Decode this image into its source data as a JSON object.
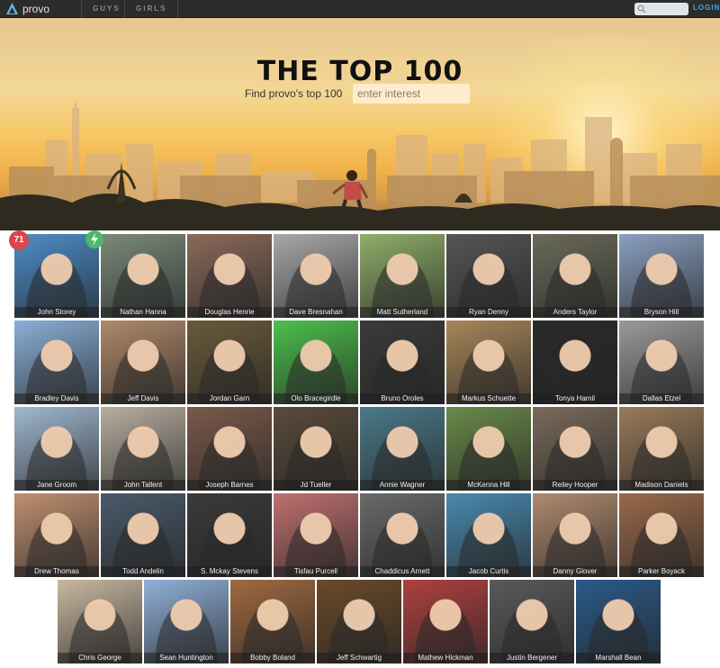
{
  "nav": {
    "brand": "provo",
    "items": [
      "GUYS",
      "GIRLS"
    ],
    "search_placeholder": "",
    "login": "LOGIN"
  },
  "hero": {
    "title": "THE TOP 100",
    "subtitle": "Find provo's top 100",
    "input_placeholder": "enter interest"
  },
  "badges": {
    "rank": "71"
  },
  "people": [
    {
      "name": "John Storey",
      "color": "#4d8ec9"
    },
    {
      "name": "Nathan Hanna",
      "color": "#7a8a7a"
    },
    {
      "name": "Douglas Henrie",
      "color": "#8a6a5a"
    },
    {
      "name": "Dave Bresnahan",
      "color": "#a8a8a8"
    },
    {
      "name": "Matt Sutherland",
      "color": "#8fae6a"
    },
    {
      "name": "Ryan Denny",
      "color": "#555555"
    },
    {
      "name": "Anders Taylor",
      "color": "#6a6a5a"
    },
    {
      "name": "Bryson Hill",
      "color": "#8aa0c0"
    },
    {
      "name": "Bradley Davis",
      "color": "#8ab0d8"
    },
    {
      "name": "Jeff Davis",
      "color": "#b08a6a"
    },
    {
      "name": "Jordan Garn",
      "color": "#6a5a3a"
    },
    {
      "name": "Olo Bracegirdle",
      "color": "#4cc04c"
    },
    {
      "name": "Bruno Oroles",
      "color": "#3a3a3a"
    },
    {
      "name": "Markus Schuette",
      "color": "#a8865a"
    },
    {
      "name": "Tonya Hamil",
      "color": "#2a2a2a"
    },
    {
      "name": "Dallas Etzel",
      "color": "#9a9a9a"
    },
    {
      "name": "Jane Groom",
      "color": "#a0b8d0"
    },
    {
      "name": "John Tallent",
      "color": "#b8aea0"
    },
    {
      "name": "Joseph Barnes",
      "color": "#7a5a4a"
    },
    {
      "name": "Jd Tueller",
      "color": "#5a4a3a"
    },
    {
      "name": "Annie Wagner",
      "color": "#4a7a8a"
    },
    {
      "name": "McKenna Hill",
      "color": "#6a8a4a"
    },
    {
      "name": "Reiley Hooper",
      "color": "#7a6a5a"
    },
    {
      "name": "Madison Daniels",
      "color": "#9a7a5a"
    },
    {
      "name": "Drew Thomas",
      "color": "#c09070"
    },
    {
      "name": "Todd Andelin",
      "color": "#4a5a6a"
    },
    {
      "name": "S. Mckay Stevens",
      "color": "#3a3a3a"
    },
    {
      "name": "Tisfau Purcell",
      "color": "#c07070"
    },
    {
      "name": "Chaddicus Arnett",
      "color": "#6a6a6a"
    },
    {
      "name": "Jacob Curtis",
      "color": "#4a8ab0"
    },
    {
      "name": "Danny Glover",
      "color": "#b08a70"
    },
    {
      "name": "Parker Boyack",
      "color": "#9a6a4a"
    },
    {
      "name": "Chris George",
      "color": "#c8b8a0"
    },
    {
      "name": "Sean Huntington",
      "color": "#90b0d8"
    },
    {
      "name": "Bobby Boland",
      "color": "#a06a40"
    },
    {
      "name": "Jeff Schwartig",
      "color": "#6a4a2a"
    },
    {
      "name": "Mathew Hickman",
      "color": "#b04040"
    },
    {
      "name": "Justin Bergener",
      "color": "#5a5a5a"
    },
    {
      "name": "Marshall Bean",
      "color": "#2a5a8a"
    }
  ]
}
